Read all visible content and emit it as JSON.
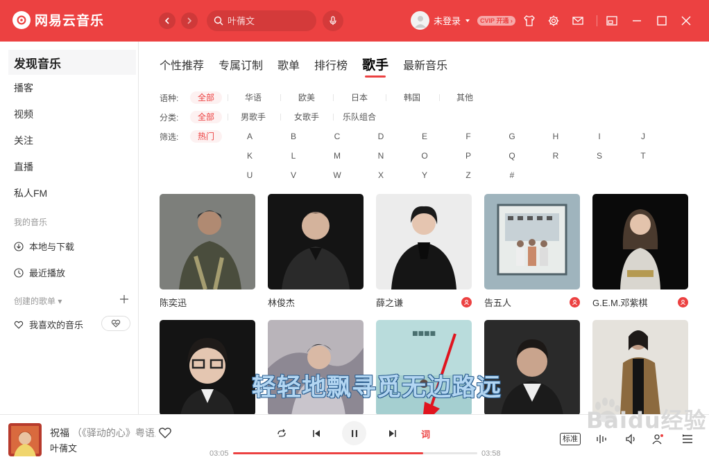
{
  "window": {
    "app_title": "网易云音乐",
    "search": {
      "placeholder": "叶蒨文"
    },
    "user": {
      "login_label": "未登录",
      "vip_label": "CVIP 开通 ›"
    }
  },
  "sidebar": {
    "items": [
      {
        "label": "发现音乐",
        "active": true
      },
      {
        "label": "播客"
      },
      {
        "label": "视频"
      },
      {
        "label": "关注"
      },
      {
        "label": "直播"
      },
      {
        "label": "私人FM"
      }
    ],
    "my_music_header": "我的音乐",
    "my_music": [
      {
        "label": "本地与下载",
        "icon": "download-icon"
      },
      {
        "label": "最近播放",
        "icon": "clock-icon"
      }
    ],
    "created_playlists_header": "创建的歌单 ▾",
    "favorites": {
      "label": "我喜欢的音乐",
      "icon": "heart-icon"
    }
  },
  "tabs": [
    {
      "label": "个性推荐"
    },
    {
      "label": "专属订制"
    },
    {
      "label": "歌单"
    },
    {
      "label": "排行榜"
    },
    {
      "label": "歌手",
      "active": true
    },
    {
      "label": "最新音乐"
    }
  ],
  "filters": {
    "language": {
      "label": "语种:",
      "options": [
        "全部",
        "华语",
        "欧美",
        "日本",
        "韩国",
        "其他"
      ],
      "selected": "全部"
    },
    "category": {
      "label": "分类:",
      "options": [
        "全部",
        "男歌手",
        "女歌手",
        "乐队组合"
      ],
      "selected": "全部"
    },
    "initial": {
      "label": "筛选:",
      "options": [
        "热门",
        "A",
        "B",
        "C",
        "D",
        "E",
        "F",
        "G",
        "H",
        "I",
        "J",
        "K",
        "L",
        "M",
        "N",
        "O",
        "P",
        "Q",
        "R",
        "S",
        "T",
        "U",
        "V",
        "W",
        "X",
        "Y",
        "Z",
        "#"
      ],
      "selected": "热门"
    }
  },
  "artists": [
    {
      "name": "陈奕迅",
      "badge": false
    },
    {
      "name": "林俊杰",
      "badge": false
    },
    {
      "name": "薛之谦",
      "badge": true
    },
    {
      "name": "告五人",
      "badge": true
    },
    {
      "name": "G.E.M.邓紫棋",
      "badge": true
    },
    {
      "name": "",
      "badge": false
    },
    {
      "name": "",
      "badge": false
    },
    {
      "name": "",
      "badge": false
    },
    {
      "name": "",
      "badge": false
    },
    {
      "name": "",
      "badge": false
    }
  ],
  "lyric_overlay": "轻轻地飘寻觅无边路远",
  "player": {
    "title": "祝福",
    "subtitle": "（《驿动的心》粤语版）",
    "artist": "叶蒨文",
    "current_time": "03:05",
    "total_time": "03:58",
    "progress": 0.777,
    "lyric_button": "词",
    "quality_label": "标准",
    "state": "playing"
  },
  "watermark": "Baidu经验",
  "colors": {
    "accent": "#ec4141",
    "lyric_fill": "#b3d6f2",
    "lyric_stroke": "#2c5f90"
  }
}
